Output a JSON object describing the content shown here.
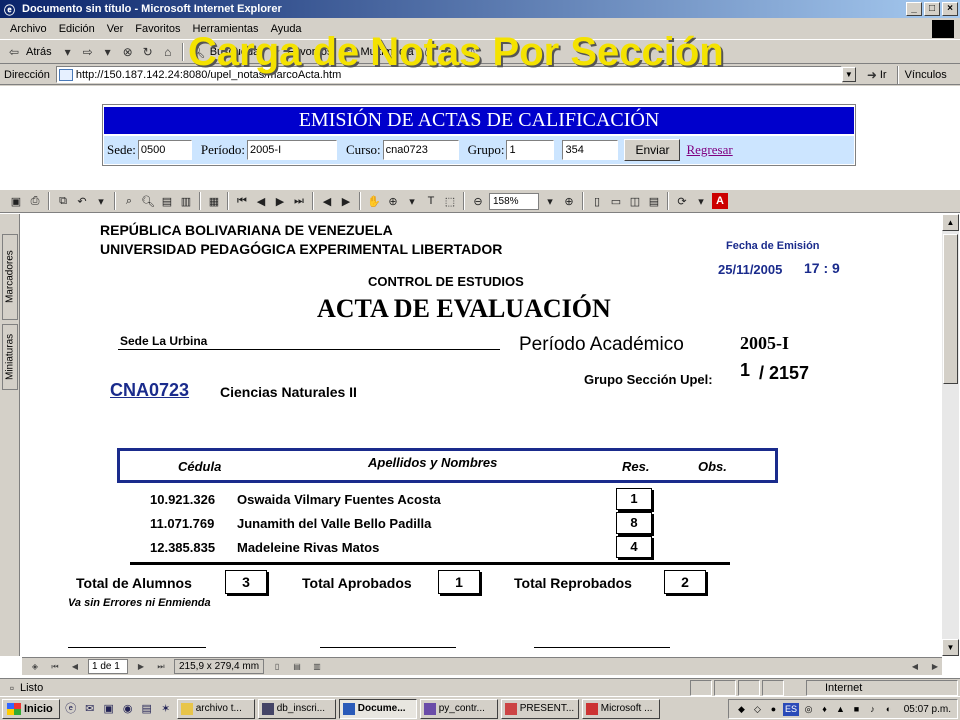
{
  "window": {
    "title": "Documento sin título - Microsoft Internet Explorer",
    "minimize": "_",
    "maximize": "□",
    "close": "×"
  },
  "menu": [
    "Archivo",
    "Edición",
    "Ver",
    "Favoritos",
    "Herramientas",
    "Ayuda"
  ],
  "toolbar": {
    "back": "Atrás",
    "search": "Búsqueda",
    "favorites": "Favoritos",
    "media": "Multimedia"
  },
  "address": {
    "label": "Dirección",
    "url": "http://150.187.142.24:8080/upel_notas/marcoActa.htm",
    "go": "Ir",
    "links": "Vínculos"
  },
  "overlay_title": "Carga de Notas Por Sección",
  "form": {
    "heading": "EMISIÓN DE ACTAS DE CALIFICACIÓN",
    "sede_label": "Sede:",
    "sede_value": "0500",
    "periodo_label": "Período:",
    "periodo_value": "2005-I",
    "curso_label": "Curso:",
    "curso_value": "cna0723",
    "grupo_label": "Grupo:",
    "grupo_value": "1",
    "extra_value": "354",
    "submit": "Enviar",
    "back_link": "Regresar"
  },
  "acrobat": {
    "zoom": "158%",
    "tab_bookmarks": "Marcadores",
    "tab_thumbnails": "Miniaturas",
    "page_indicator": "1 de 1",
    "page_size": "215,9 x 279,4",
    "page_size_unit": "mm"
  },
  "document": {
    "republic": "REPÚBLICA BOLIVARIANA DE VENEZUELA",
    "university": "UNIVERSIDAD PEDAGÓGICA EXPERIMENTAL LIBERTADOR",
    "emission_label": "Fecha de Emisión",
    "emission_date": "25/11/2005",
    "emission_time": "17 : 9",
    "control": "CONTROL DE ESTUDIOS",
    "title": "ACTA DE EVALUACIÓN",
    "sede": "Sede La Urbina",
    "periodo_label": "Período Académico",
    "periodo": "2005-I",
    "grupo_label": "Grupo Sección Upel:",
    "grupo": "1",
    "seccion": "/ 2157",
    "course_code": "CNA0723",
    "course_name": "Ciencias Naturales II",
    "headers": {
      "cedula": "Cédula",
      "nombres": "Apellidos y Nombres",
      "res": "Res.",
      "obs": "Obs."
    },
    "students": [
      {
        "cedula": "10.921.326",
        "nombre": "Oswaida Vilmary Fuentes Acosta",
        "res": "1"
      },
      {
        "cedula": "11.071.769",
        "nombre": "Junamith del Valle Bello Padilla",
        "res": "8"
      },
      {
        "cedula": "12.385.835",
        "nombre": "Madeleine  Rivas Matos",
        "res": "4"
      }
    ],
    "total_alumnos_label": "Total de Alumnos",
    "total_alumnos": "3",
    "total_aprobados_label": "Total Aprobados",
    "total_aprobados": "1",
    "total_reprobados_label": "Total Reprobados",
    "total_reprobados": "2",
    "note": "Va sin Errores ni Enmienda"
  },
  "statusbar": {
    "status": "Listo",
    "zone": "Internet"
  },
  "taskbar": {
    "start": "Inicio",
    "buttons": [
      "archivo t...",
      "db_inscri...",
      "Docume...",
      "py_contr...",
      "PRESENT...",
      "Microsoft ..."
    ],
    "lang": "ES",
    "clock": "05:07 p.m."
  }
}
